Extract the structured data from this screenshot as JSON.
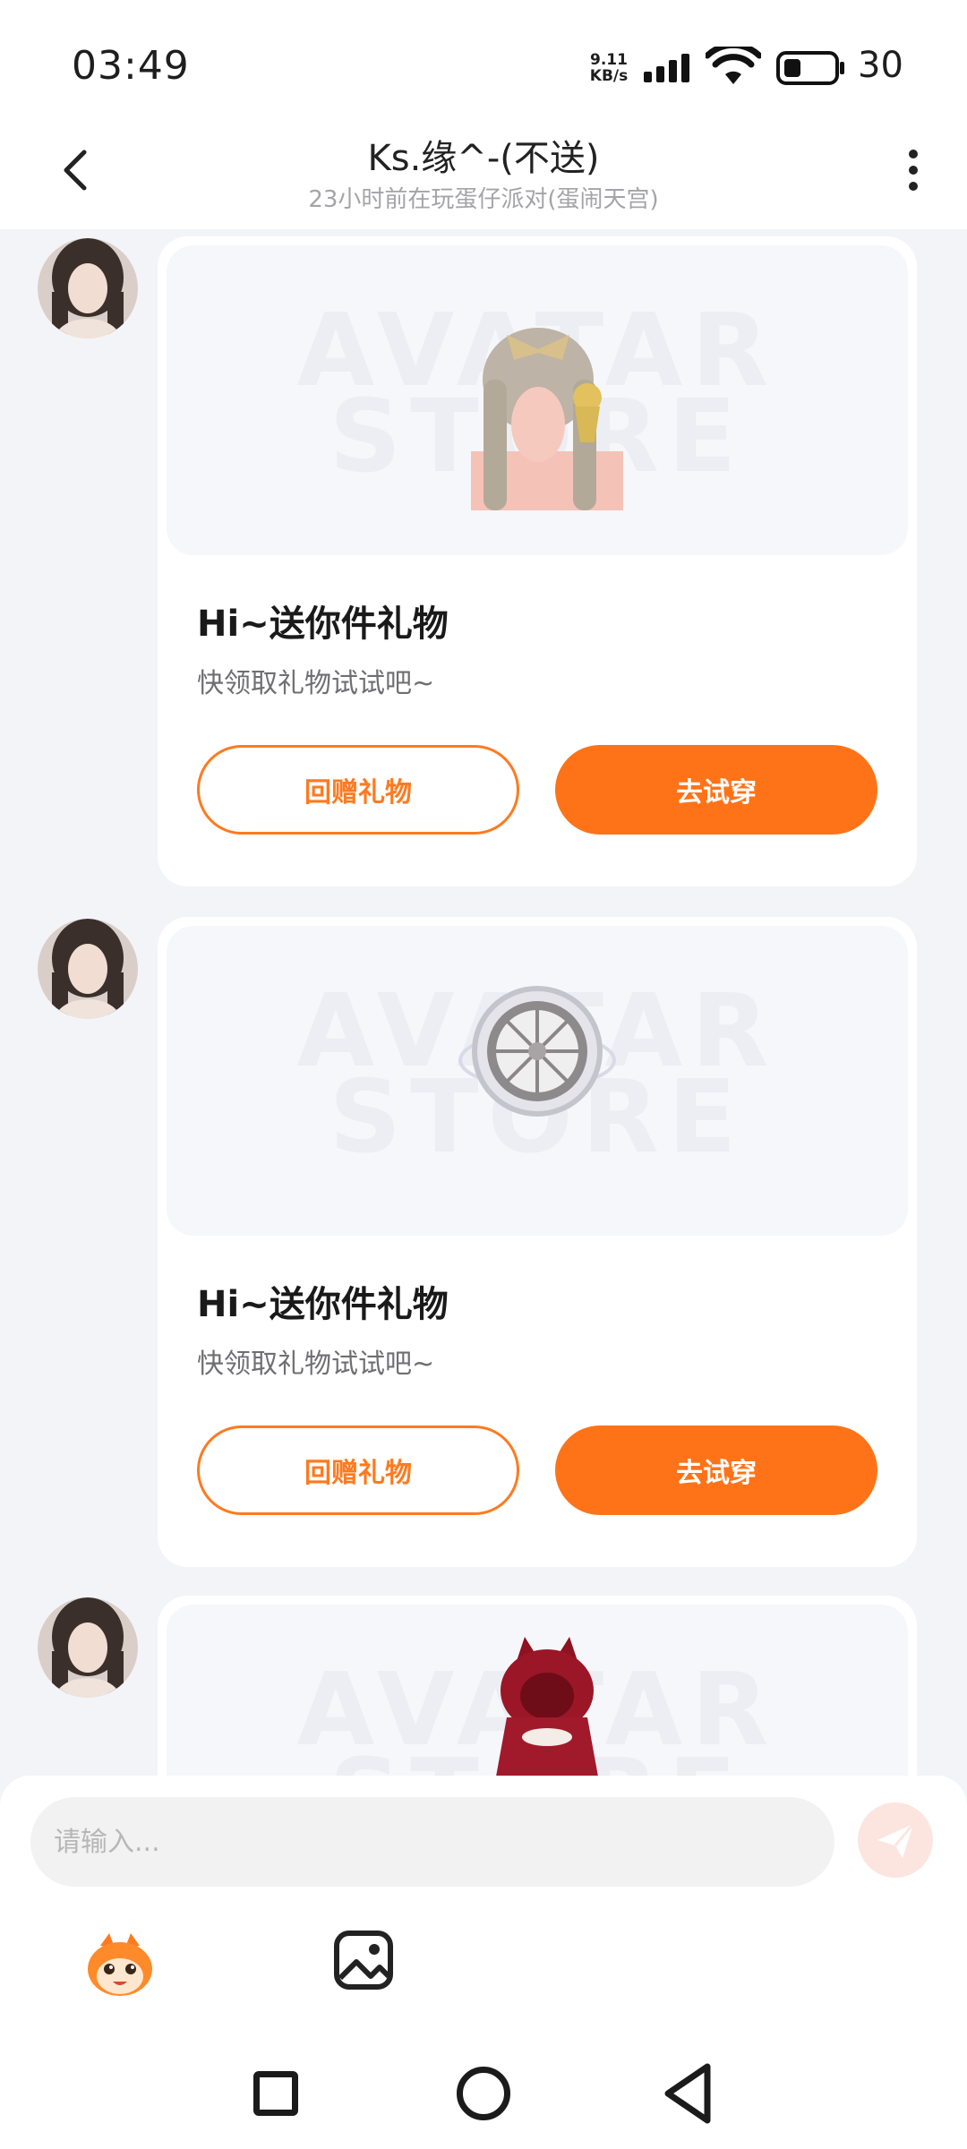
{
  "status_bar": {
    "time": "03:49",
    "net_speed_value": "9.11",
    "net_speed_unit": "KB/s",
    "battery": "30"
  },
  "header": {
    "title": "Ks.缘^-(不送)",
    "subtitle": "23小时前在玩蛋仔派对(蛋闹天宫)"
  },
  "messages": [
    {
      "title": "Hi~送你件礼物",
      "desc": "快领取礼物试试吧~",
      "return_label": "回赠礼物",
      "try_label": "去试穿",
      "watermark": "AVATAR STORE",
      "item": "hair-accessory-image"
    },
    {
      "title": "Hi~送你件礼物",
      "desc": "快领取礼物试试吧~",
      "return_label": "回赠礼物",
      "try_label": "去试穿",
      "watermark": "AVATAR STORE",
      "item": "halo-wheel-image"
    },
    {
      "watermark": "AVATAR STORE",
      "item": "red-hood-cape-image"
    }
  ],
  "input": {
    "placeholder": "请输入..."
  },
  "colors": {
    "accent": "#ff7318",
    "send_disabled": "#fde5df"
  }
}
